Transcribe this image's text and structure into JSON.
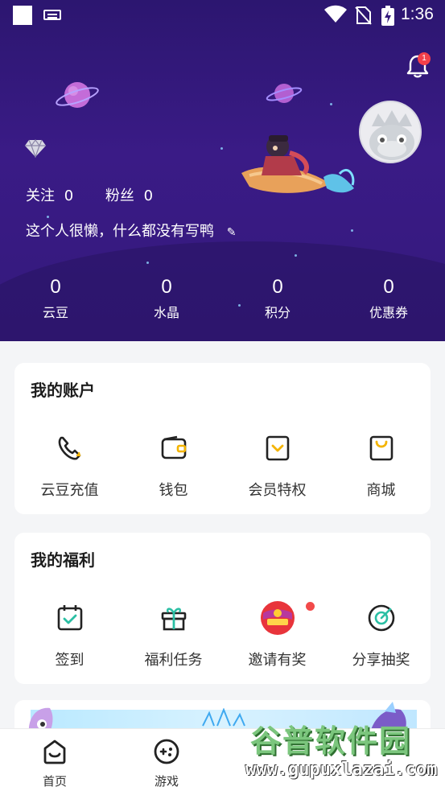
{
  "status_bar": {
    "time": "1:36"
  },
  "header": {
    "notification_count": "1",
    "follow": {
      "label": "关注",
      "value": "0"
    },
    "fans": {
      "label": "粉丝",
      "value": "0"
    },
    "bio": "这个人很懒，什么都没有写鸭",
    "stats": [
      {
        "value": "0",
        "label": "云豆"
      },
      {
        "value": "0",
        "label": "水晶"
      },
      {
        "value": "0",
        "label": "积分"
      },
      {
        "value": "0",
        "label": "优惠券"
      }
    ]
  },
  "account": {
    "title": "我的账户",
    "items": [
      {
        "label": "云豆充值",
        "icon": "phone-charge-icon"
      },
      {
        "label": "钱包",
        "icon": "wallet-icon"
      },
      {
        "label": "会员特权",
        "icon": "vip-icon"
      },
      {
        "label": "商城",
        "icon": "shop-bag-icon"
      }
    ]
  },
  "welfare": {
    "title": "我的福利",
    "items": [
      {
        "label": "签到",
        "icon": "calendar-check-icon"
      },
      {
        "label": "福利任务",
        "icon": "gift-icon"
      },
      {
        "label": "邀请有奖",
        "icon": "red-envelope-icon",
        "red_dot": true
      },
      {
        "label": "分享抽奖",
        "icon": "lottery-icon"
      }
    ]
  },
  "bottom_nav": [
    {
      "label": "首页",
      "icon": "home-icon"
    },
    {
      "label": "游戏",
      "icon": "gamepad-icon"
    }
  ],
  "watermark": {
    "title": "谷普软件园",
    "url": "www.gupuxlazai.com"
  },
  "colors": {
    "accent": "#f4b400",
    "header_bg": "#34197c",
    "badge": "#f4404a"
  }
}
